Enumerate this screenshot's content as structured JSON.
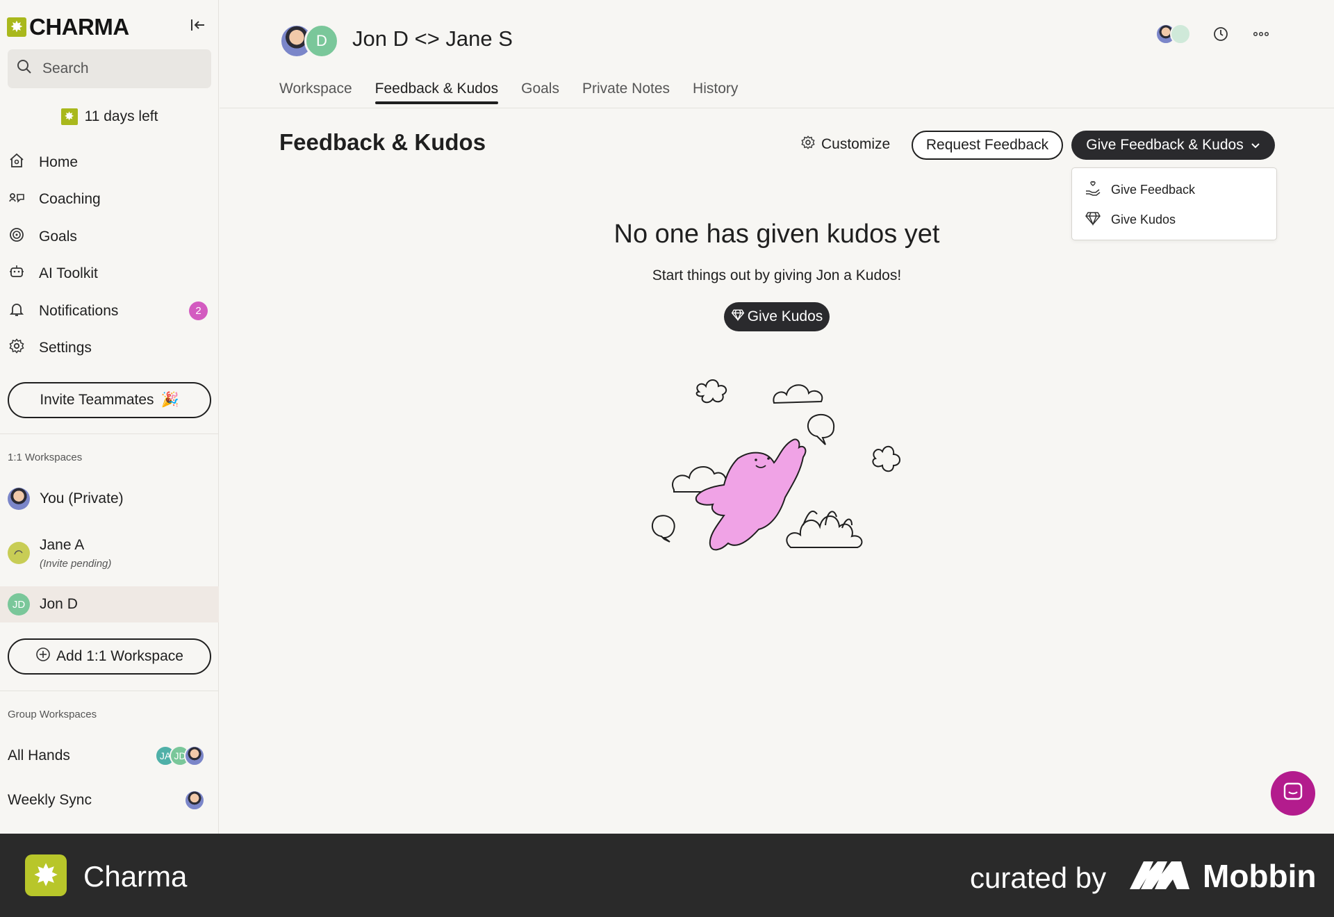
{
  "brand": {
    "name": "CHARMA",
    "icon": "sparkle-icon",
    "accent": "#a9b81c"
  },
  "sidebar": {
    "search_placeholder": "Search",
    "trial": "11 days left",
    "nav": [
      {
        "label": "Home",
        "icon": "home-icon"
      },
      {
        "label": "Coaching",
        "icon": "coaching-icon"
      },
      {
        "label": "Goals",
        "icon": "target-icon"
      },
      {
        "label": "AI Toolkit",
        "icon": "robot-icon"
      },
      {
        "label": "Notifications",
        "icon": "bell-icon",
        "badge": "2"
      },
      {
        "label": "Settings",
        "icon": "gear-icon"
      }
    ],
    "invite_label": "Invite Teammates",
    "one_on_one_label": "1:1 Workspaces",
    "workspaces": [
      {
        "name": "You (Private)"
      },
      {
        "name": "Jane A",
        "sub": "(Invite pending)"
      },
      {
        "name": "Jon D",
        "initials": "JD"
      }
    ],
    "add_workspace_label": "Add 1:1 Workspace",
    "group_label": "Group Workspaces",
    "groups": [
      {
        "name": "All Hands",
        "avatars": [
          "JA",
          "JD"
        ]
      },
      {
        "name": "Weekly Sync"
      }
    ]
  },
  "header": {
    "title": "Jon D <> Jane S",
    "avatar_initial": "D",
    "tabs": [
      "Workspace",
      "Feedback & Kudos",
      "Goals",
      "Private Notes",
      "History"
    ],
    "active_tab": "Feedback & Kudos"
  },
  "main": {
    "title": "Feedback & Kudos",
    "customize_label": "Customize",
    "request_label": "Request Feedback",
    "give_label": "Give Feedback & Kudos",
    "dropdown": [
      {
        "label": "Give Feedback",
        "icon": "hand-heart-icon"
      },
      {
        "label": "Give Kudos",
        "icon": "diamond-icon"
      }
    ],
    "empty_title": "No one has given kudos yet",
    "empty_subtitle": "Start things out by giving Jon a Kudos!",
    "give_kudos_label": "Give Kudos"
  },
  "footer": {
    "app_name": "Charma",
    "curated": "curated by",
    "mobbin": "Mobbin"
  },
  "colors": {
    "dark_button": "#2a2a2d",
    "badge": "#d35bc0",
    "chat_fab": "#b31c8d",
    "illustration_pink": "#f0a3e6"
  }
}
